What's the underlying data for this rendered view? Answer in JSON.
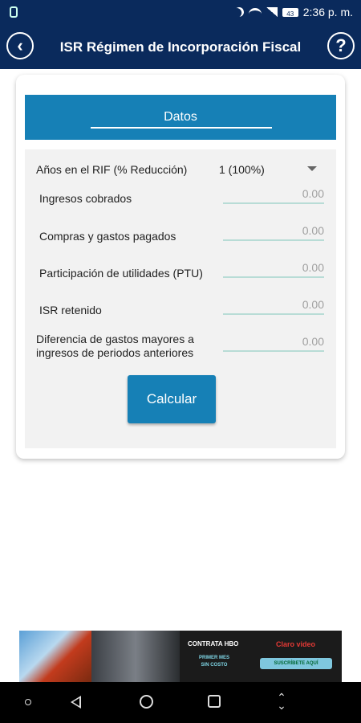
{
  "status_bar": {
    "time": "2:36 p. m.",
    "battery": "43"
  },
  "header": {
    "title": "ISR Régimen de Incorporación Fiscal",
    "back_icon": "chevron-left-icon",
    "help_label": "?"
  },
  "tab": {
    "label": "Datos"
  },
  "form": {
    "years": {
      "label": "Años en el RIF (% Reducción)",
      "value": "1 (100%)"
    },
    "fields": [
      {
        "label": "Ingresos cobrados",
        "placeholder": "0.00"
      },
      {
        "label": "Compras y gastos pagados",
        "placeholder": "0.00"
      },
      {
        "label": "Participación de utilidades (PTU)",
        "placeholder": "0.00"
      },
      {
        "label": "ISR retenido",
        "placeholder": "0.00"
      },
      {
        "label_line1": "Diferencia de gastos mayores a",
        "label_line2": "ingresos de periodos anteriores",
        "placeholder": "0.00"
      }
    ],
    "submit_label": "Calcular"
  },
  "ad": {
    "text_contract": "CONTRATA HBO",
    "text_offer_1": "PRIMER MES",
    "text_offer_2": "SIN COSTO",
    "brand": "Claro video",
    "cta": "SUSCRÍBETE AQUÍ"
  },
  "colors": {
    "header_bg": "#0a2a5c",
    "accent": "#1680b6",
    "input_underline": "#b8dcd6",
    "form_bg": "#f2f2f2"
  }
}
